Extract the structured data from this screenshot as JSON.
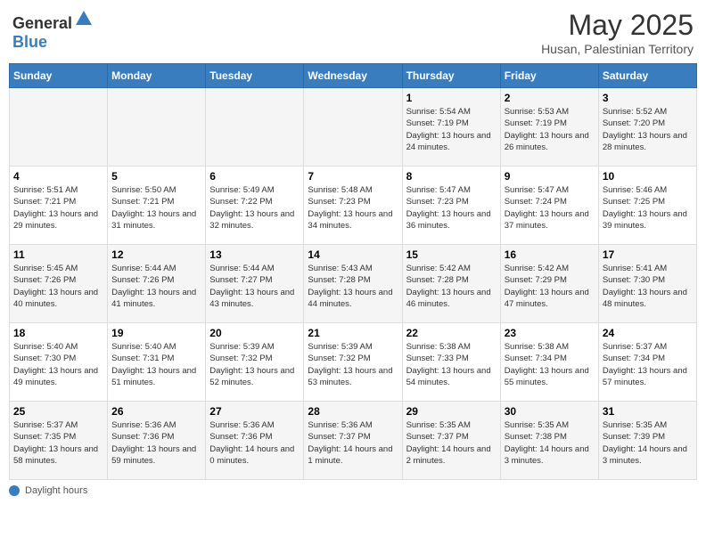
{
  "logo": {
    "general": "General",
    "blue": "Blue"
  },
  "title": "May 2025",
  "subtitle": "Husan, Palestinian Territory",
  "days_of_week": [
    "Sunday",
    "Monday",
    "Tuesday",
    "Wednesday",
    "Thursday",
    "Friday",
    "Saturday"
  ],
  "footer_label": "Daylight hours",
  "weeks": [
    [
      {
        "day": "",
        "info": ""
      },
      {
        "day": "",
        "info": ""
      },
      {
        "day": "",
        "info": ""
      },
      {
        "day": "",
        "info": ""
      },
      {
        "day": "1",
        "info": "Sunrise: 5:54 AM\nSunset: 7:19 PM\nDaylight: 13 hours and 24 minutes."
      },
      {
        "day": "2",
        "info": "Sunrise: 5:53 AM\nSunset: 7:19 PM\nDaylight: 13 hours and 26 minutes."
      },
      {
        "day": "3",
        "info": "Sunrise: 5:52 AM\nSunset: 7:20 PM\nDaylight: 13 hours and 28 minutes."
      }
    ],
    [
      {
        "day": "4",
        "info": "Sunrise: 5:51 AM\nSunset: 7:21 PM\nDaylight: 13 hours and 29 minutes."
      },
      {
        "day": "5",
        "info": "Sunrise: 5:50 AM\nSunset: 7:21 PM\nDaylight: 13 hours and 31 minutes."
      },
      {
        "day": "6",
        "info": "Sunrise: 5:49 AM\nSunset: 7:22 PM\nDaylight: 13 hours and 32 minutes."
      },
      {
        "day": "7",
        "info": "Sunrise: 5:48 AM\nSunset: 7:23 PM\nDaylight: 13 hours and 34 minutes."
      },
      {
        "day": "8",
        "info": "Sunrise: 5:47 AM\nSunset: 7:23 PM\nDaylight: 13 hours and 36 minutes."
      },
      {
        "day": "9",
        "info": "Sunrise: 5:47 AM\nSunset: 7:24 PM\nDaylight: 13 hours and 37 minutes."
      },
      {
        "day": "10",
        "info": "Sunrise: 5:46 AM\nSunset: 7:25 PM\nDaylight: 13 hours and 39 minutes."
      }
    ],
    [
      {
        "day": "11",
        "info": "Sunrise: 5:45 AM\nSunset: 7:26 PM\nDaylight: 13 hours and 40 minutes."
      },
      {
        "day": "12",
        "info": "Sunrise: 5:44 AM\nSunset: 7:26 PM\nDaylight: 13 hours and 41 minutes."
      },
      {
        "day": "13",
        "info": "Sunrise: 5:44 AM\nSunset: 7:27 PM\nDaylight: 13 hours and 43 minutes."
      },
      {
        "day": "14",
        "info": "Sunrise: 5:43 AM\nSunset: 7:28 PM\nDaylight: 13 hours and 44 minutes."
      },
      {
        "day": "15",
        "info": "Sunrise: 5:42 AM\nSunset: 7:28 PM\nDaylight: 13 hours and 46 minutes."
      },
      {
        "day": "16",
        "info": "Sunrise: 5:42 AM\nSunset: 7:29 PM\nDaylight: 13 hours and 47 minutes."
      },
      {
        "day": "17",
        "info": "Sunrise: 5:41 AM\nSunset: 7:30 PM\nDaylight: 13 hours and 48 minutes."
      }
    ],
    [
      {
        "day": "18",
        "info": "Sunrise: 5:40 AM\nSunset: 7:30 PM\nDaylight: 13 hours and 49 minutes."
      },
      {
        "day": "19",
        "info": "Sunrise: 5:40 AM\nSunset: 7:31 PM\nDaylight: 13 hours and 51 minutes."
      },
      {
        "day": "20",
        "info": "Sunrise: 5:39 AM\nSunset: 7:32 PM\nDaylight: 13 hours and 52 minutes."
      },
      {
        "day": "21",
        "info": "Sunrise: 5:39 AM\nSunset: 7:32 PM\nDaylight: 13 hours and 53 minutes."
      },
      {
        "day": "22",
        "info": "Sunrise: 5:38 AM\nSunset: 7:33 PM\nDaylight: 13 hours and 54 minutes."
      },
      {
        "day": "23",
        "info": "Sunrise: 5:38 AM\nSunset: 7:34 PM\nDaylight: 13 hours and 55 minutes."
      },
      {
        "day": "24",
        "info": "Sunrise: 5:37 AM\nSunset: 7:34 PM\nDaylight: 13 hours and 57 minutes."
      }
    ],
    [
      {
        "day": "25",
        "info": "Sunrise: 5:37 AM\nSunset: 7:35 PM\nDaylight: 13 hours and 58 minutes."
      },
      {
        "day": "26",
        "info": "Sunrise: 5:36 AM\nSunset: 7:36 PM\nDaylight: 13 hours and 59 minutes."
      },
      {
        "day": "27",
        "info": "Sunrise: 5:36 AM\nSunset: 7:36 PM\nDaylight: 14 hours and 0 minutes."
      },
      {
        "day": "28",
        "info": "Sunrise: 5:36 AM\nSunset: 7:37 PM\nDaylight: 14 hours and 1 minute."
      },
      {
        "day": "29",
        "info": "Sunrise: 5:35 AM\nSunset: 7:37 PM\nDaylight: 14 hours and 2 minutes."
      },
      {
        "day": "30",
        "info": "Sunrise: 5:35 AM\nSunset: 7:38 PM\nDaylight: 14 hours and 3 minutes."
      },
      {
        "day": "31",
        "info": "Sunrise: 5:35 AM\nSunset: 7:39 PM\nDaylight: 14 hours and 3 minutes."
      }
    ]
  ]
}
